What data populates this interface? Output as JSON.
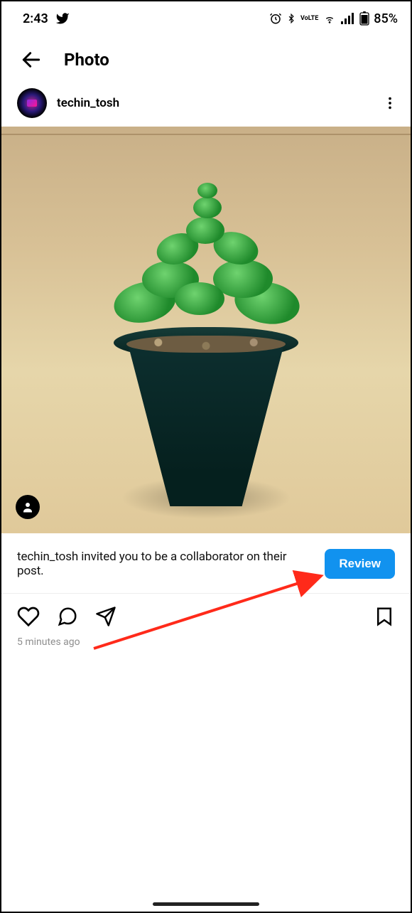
{
  "status_bar": {
    "time": "2:43",
    "battery_percent": "85%",
    "volte": "VoLTE",
    "icons": [
      "twitter",
      "alarm",
      "bluetooth",
      "wifi",
      "signal",
      "battery"
    ]
  },
  "header": {
    "title": "Photo"
  },
  "post": {
    "username": "techin_tosh",
    "collab_text": "techin_tosh invited you to be a collaborator on their post.",
    "review_button": "Review",
    "timestamp": "5 minutes ago"
  }
}
